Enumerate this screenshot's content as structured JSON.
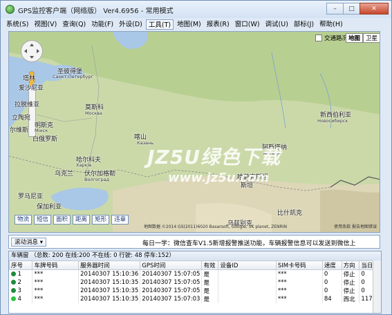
{
  "window": {
    "title": "GPS监控客户端（网络版） Ver4.6956 - 常用模式",
    "min": "–",
    "max": "□",
    "close": "✕"
  },
  "menu": [
    "系统(S)",
    "视图(V)",
    "查询(Q)",
    "功能(F)",
    "外设(D)",
    "工具(T)",
    "地图(M)",
    "报表(R)",
    "窗口(W)",
    "调试(U)",
    "部标(J)",
    "帮助(H)"
  ],
  "map": {
    "traffic_label": "交通路况",
    "type_map": "地图",
    "type_satellite": "卫星",
    "labels": {
      "tallinn": "塔林",
      "petersburg_cn": "圣彼得堡",
      "petersburg_ru": "Санкт-Петербург",
      "estonia": "爱沙尼亚",
      "latvia": "拉脱维亚",
      "moscow_cn": "莫斯科",
      "moscow_ru": "Москва",
      "lithuania": "立陶宛",
      "minsk": "明斯克",
      "minsk_ru": "Мінск",
      "belarus": "白俄罗斯",
      "poland": "尔维斯",
      "kazan": "喀山",
      "kazan_ru": "Казань",
      "kharkiv": "哈尔科夫",
      "kharkiv_ru": "Харків",
      "ukraine": "乌克兰",
      "volgograd": "伏尔加格勒",
      "volgograd_ru": "Волгоград",
      "romania": "罗马尼亚",
      "russia": "俄罗斯",
      "novosibirsk": "新西伯利亚",
      "novosibirsk_ru": "Новосибирск",
      "astana": "阿斯塔纳",
      "astana_ru": "Астана",
      "kazakhstan": "哈萨克斯坦",
      "uzbekistan": "乌兹别克",
      "bishkek": "比什凯克",
      "bishkek_ru": "Бишкек",
      "poland_short": "拉陶宛",
      "aftan": "阿斯坦",
      "nowosi": "斯坦",
      "bulgaria": "保加利亚",
      "georgia": "亚"
    },
    "tools": [
      "物流",
      "短信",
      "面积",
      "距离",
      "矩形",
      "违章"
    ],
    "copyright": "地图数据 ©2014 GS(2011)6020 Basarsoft, Google, SK planet, ZENRIN",
    "terms": "使用条款  报告地图错误",
    "watermark_main": "JZ5U绿色下载",
    "watermark_url": "www.jz5u.com"
  },
  "infobar": {
    "scroll_label": "滚动消息",
    "dropdown": "▾",
    "notice": "每日一学：微信查车V1.5新增报警推送功能，车辆报警信息可以发送到微信上"
  },
  "vehicles": {
    "panel_title": "车辆窗",
    "summary": "（总数: 200 在线:200 不在线: 0 行驶: 48 停车:152）",
    "columns": [
      "序号",
      "车牌号码",
      "服务器时间",
      "GPS时间",
      "有效",
      "设备ID",
      "SIM卡号码",
      "速度",
      "方向",
      "当日里"
    ],
    "rows": [
      {
        "no": "1",
        "plate": "***",
        "server_time": "20140307 15:10:36",
        "gps_time": "20140307 15:07:05",
        "valid": "是",
        "device": "",
        "sim": "***",
        "speed": "0",
        "dir": "停止",
        "mileage": "0",
        "status_color": "#1f8a3a"
      },
      {
        "no": "2",
        "plate": "***",
        "server_time": "20140307 15:10:35",
        "gps_time": "20140307 15:07:05",
        "valid": "是",
        "device": "",
        "sim": "***",
        "speed": "0",
        "dir": "停止",
        "mileage": "0",
        "status_color": "#1f8a3a"
      },
      {
        "no": "3",
        "plate": "***",
        "server_time": "20140307 15:10:35",
        "gps_time": "20140307 15:07:05",
        "valid": "是",
        "device": "",
        "sim": "***",
        "speed": "0",
        "dir": "停止",
        "mileage": "0",
        "status_color": "#1f8a3a"
      },
      {
        "no": "4",
        "plate": "***",
        "server_time": "20140307 15:10:35",
        "gps_time": "20140307 15:07:03",
        "valid": "是",
        "device": "",
        "sim": "***",
        "speed": "84",
        "dir": "西北",
        "mileage": "117",
        "status_color": "#2ec43e"
      }
    ]
  }
}
